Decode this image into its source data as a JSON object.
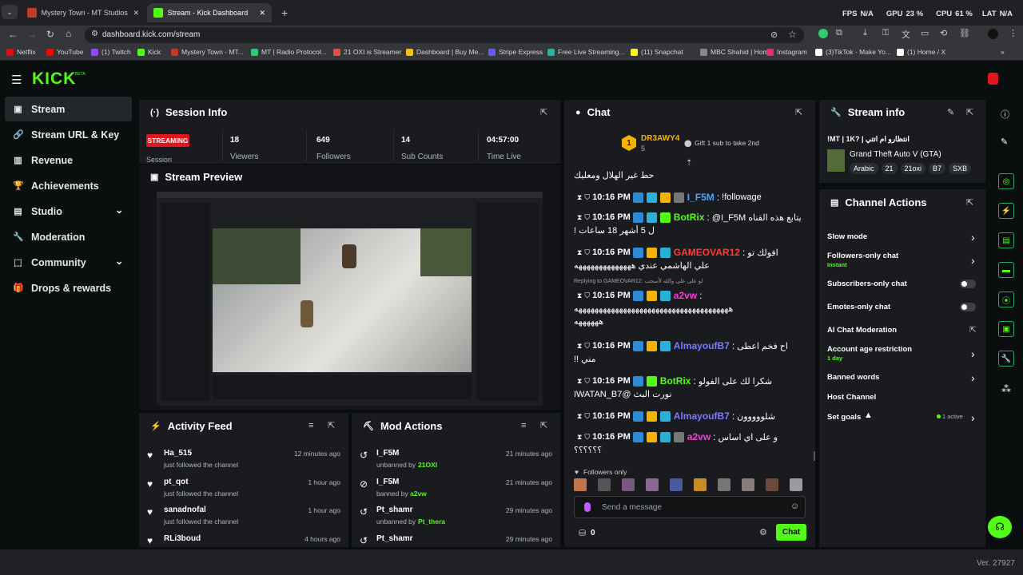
{
  "browser": {
    "tabs": [
      {
        "label": "Mystery Town - MT Studios | M",
        "icon_color": "#c0392b"
      },
      {
        "label": "Stream - Kick Dashboard",
        "icon_color": "#53fc18"
      }
    ],
    "new_tab": "+",
    "url": "dashboard.kick.com/stream",
    "perf": {
      "fps_label": "FPS",
      "fps_value": "N/A",
      "gpu_label": "GPU",
      "gpu_value": "23 %",
      "cpu_label": "CPU",
      "cpu_value": "61 %",
      "lat_label": "LAT",
      "lat_value": "N/A"
    },
    "bookmarks": [
      {
        "label": "Netflix",
        "color": "#e50914"
      },
      {
        "label": "YouTube",
        "color": "#ff0000"
      },
      {
        "label": "(1) Twitch",
        "color": "#9146ff"
      },
      {
        "label": "Kick",
        "color": "#53fc18"
      },
      {
        "label": "Mystery Town - MT...",
        "color": "#c0392b"
      },
      {
        "label": "MT | Radio Protocol...",
        "color": "#2ecc71"
      },
      {
        "label": "21 OXI is Streamer",
        "color": "#e74c3c"
      },
      {
        "label": "Dashboard | Buy Me...",
        "color": "#f1c40f"
      },
      {
        "label": "Stripe Express",
        "color": "#635bff"
      },
      {
        "label": "Free Live Streaming...",
        "color": "#1abc9c"
      },
      {
        "label": "(11) Snapchat",
        "color": "#fffc00"
      },
      {
        "label": "MBC Shahid | Home",
        "color": "#888888"
      },
      {
        "label": "Instagram",
        "color": "#e1306c"
      },
      {
        "label": "(3)TikTok - Make Yo...",
        "color": "#ffffff"
      },
      {
        "label": "(1) Home / X",
        "color": "#ffffff"
      }
    ]
  },
  "app": {
    "logo": "KICK",
    "logo_sup": "BETA",
    "version": "Ver. 27927"
  },
  "sidebar": [
    {
      "label": "Stream",
      "icon": "stream-icon",
      "glyph": "▣",
      "active": true
    },
    {
      "label": "Stream URL & Key",
      "icon": "link-icon",
      "glyph": "🔗"
    },
    {
      "label": "Revenue",
      "icon": "revenue-icon",
      "glyph": "▥"
    },
    {
      "label": "Achievements",
      "icon": "trophy-icon",
      "glyph": "🏆"
    },
    {
      "label": "Studio",
      "icon": "studio-icon",
      "glyph": "▤",
      "chevron": true
    },
    {
      "label": "Moderation",
      "icon": "wrench-icon",
      "glyph": "🔧"
    },
    {
      "label": "Community",
      "icon": "community-icon",
      "glyph": "⬚",
      "chevron": true
    },
    {
      "label": "Drops & rewards",
      "icon": "gift-icon",
      "glyph": "🎁"
    }
  ],
  "session": {
    "title": "Session Info",
    "status": "STREAMING",
    "session_label": "Session",
    "stats": [
      {
        "value": "18",
        "label": "Viewers"
      },
      {
        "value": "649",
        "label": "Followers"
      },
      {
        "value": "14",
        "label": "Sub Counts"
      },
      {
        "value": "04:57:00",
        "label": "Time Live"
      }
    ]
  },
  "preview": {
    "title": "Stream Preview"
  },
  "activity": {
    "title": "Activity Feed",
    "items": [
      {
        "user": "Ha_515",
        "action": "just followed the channel",
        "time": "12 minutes ago"
      },
      {
        "user": "pt_qot",
        "action": "just followed the channel",
        "time": "1 hour ago"
      },
      {
        "user": "sanadnofal",
        "action": "just followed the channel",
        "time": "1 hour ago"
      },
      {
        "user": "RLi3boud",
        "action": "",
        "time": "4 hours ago"
      }
    ]
  },
  "mod": {
    "title": "Mod Actions",
    "items": [
      {
        "user": "I_F5M",
        "action": "unbanned by",
        "by": "21OXI",
        "time": "21 minutes ago"
      },
      {
        "user": "I_F5M",
        "action": "banned by",
        "by": "a2vw",
        "time": "21 minutes ago"
      },
      {
        "user": "Pt_shamr",
        "action": "unbanned by",
        "by": "Pt_thera",
        "time": "29 minutes ago"
      },
      {
        "user": "Pt_shamr",
        "action": "",
        "by": "",
        "time": "29 minutes ago"
      }
    ]
  },
  "chat": {
    "title": "Chat",
    "pinned": {
      "user": "DR3AWY4",
      "count": "5",
      "gift": "Gift 1 sub to take 2nd",
      "rank": "1"
    },
    "first_line": "حط غير الهلال ومعليك",
    "messages": [
      {
        "time": "10:16 PM",
        "user": "I_F5M",
        "color": "#4aa3ff",
        "text": "!followage"
      },
      {
        "time": "10:16 PM",
        "user": "BotRix",
        "color": "#53fc18",
        "text": "@I_F5M يتابع هذه القناه",
        "text2": "ل 5 أشهر 18 ساعات !"
      },
      {
        "time": "10:16 PM",
        "user": "GAMEOVAR12",
        "color": "#ff3b3b",
        "text": "افولك تو",
        "text2": "علي الهاشمي عندي ههههههههههههههه"
      },
      {
        "reply": "Replying to GAMEOVAR12: لو على على والله لأسحب",
        "time": "10:16 PM",
        "user": "a2vw",
        "color": "#ff3bd8",
        "text": "",
        "text2": "ههههههههههههههههههههههههههههههههههههههه",
        "text3": "ههههههه"
      },
      {
        "time": "10:16 PM",
        "user": "AlmayoufB7",
        "color": "#7b7bff",
        "text": "اح فخم اعطى",
        "text2": "مني !!"
      },
      {
        "time": "10:16 PM",
        "user": "BotRix",
        "color": "#53fc18",
        "text": "شكرا لك على الفولو",
        "text2": "نورت البث @IWATAN_B7"
      },
      {
        "time": "10:16 PM",
        "user": "AlmayoufB7",
        "color": "#7b7bff",
        "text": "شلووووون"
      },
      {
        "time": "10:16 PM",
        "user": "a2vw",
        "color": "#ff3bd8",
        "text": "و على اي اساس",
        "text2": "؟؟؟؟؟؟"
      }
    ],
    "followers_only": "Followers only",
    "placeholder": "Send a message",
    "points": "0",
    "send": "Chat"
  },
  "stream_info": {
    "title": "Stream info",
    "stream_title": "!MT | 1K? | انتظارو ام اتتي",
    "category": "Grand Theft Auto V (GTA)",
    "tags": [
      "Arabic",
      "21",
      "21oxi",
      "B7",
      "SXB"
    ]
  },
  "channel_actions": {
    "title": "Channel Actions",
    "items": [
      {
        "label": "Slow mode",
        "control": "chevron"
      },
      {
        "label": "Followers-only chat",
        "sub": "Instant",
        "control": "chevron"
      },
      {
        "label": "Subscribers-only chat",
        "control": "toggle"
      },
      {
        "label": "Emotes-only chat",
        "control": "toggle"
      },
      {
        "label": "AI Chat Moderation",
        "control": "external"
      },
      {
        "label": "Account age restriction",
        "sub": "1 day",
        "control": "chevron"
      },
      {
        "label": "Banned words",
        "control": "chevron"
      },
      {
        "label": "Host Channel",
        "control": "none"
      },
      {
        "label": "Set goals",
        "active": "1 active",
        "control": "chevron"
      }
    ]
  },
  "colors": {
    "accent": "#53fc18",
    "panel": "#191b1f",
    "bg": "#0b0e0f",
    "streaming": "#e0161f"
  }
}
